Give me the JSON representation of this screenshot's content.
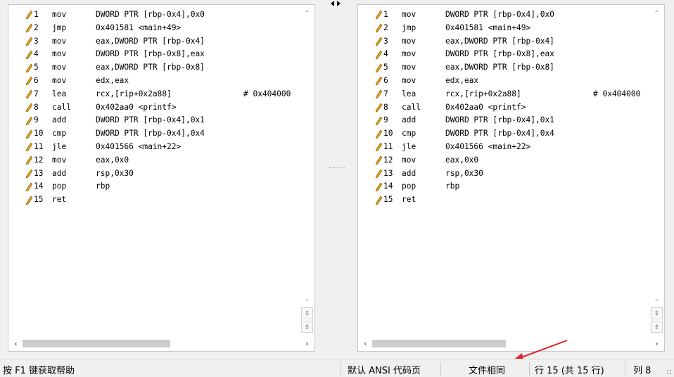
{
  "window": {
    "splitter_icon": "split-arrows-icon"
  },
  "left_pane": {
    "lines": [
      {
        "num": "1",
        "mnemonic": "mov",
        "operands": "DWORD PTR [rbp-0x4],0x0",
        "comment": ""
      },
      {
        "num": "2",
        "mnemonic": "jmp",
        "operands": "0x401581 <main+49>",
        "comment": ""
      },
      {
        "num": "3",
        "mnemonic": "mov",
        "operands": "eax,DWORD PTR [rbp-0x4]",
        "comment": ""
      },
      {
        "num": "4",
        "mnemonic": "mov",
        "operands": "DWORD PTR [rbp-0x8],eax",
        "comment": ""
      },
      {
        "num": "5",
        "mnemonic": "mov",
        "operands": "eax,DWORD PTR [rbp-0x8]",
        "comment": ""
      },
      {
        "num": "6",
        "mnemonic": "mov",
        "operands": "edx,eax",
        "comment": ""
      },
      {
        "num": "7",
        "mnemonic": "lea",
        "operands": "rcx,[rip+0x2a88]",
        "comment": "# 0x404000"
      },
      {
        "num": "8",
        "mnemonic": "call",
        "operands": "0x402aa0 <printf>",
        "comment": ""
      },
      {
        "num": "9",
        "mnemonic": "add",
        "operands": "DWORD PTR [rbp-0x4],0x1",
        "comment": ""
      },
      {
        "num": "10",
        "mnemonic": "cmp",
        "operands": "DWORD PTR [rbp-0x4],0x4",
        "comment": ""
      },
      {
        "num": "11",
        "mnemonic": "jle",
        "operands": "0x401566 <main+22>",
        "comment": ""
      },
      {
        "num": "12",
        "mnemonic": "mov",
        "operands": "eax,0x0",
        "comment": ""
      },
      {
        "num": "13",
        "mnemonic": "add",
        "operands": "rsp,0x30",
        "comment": ""
      },
      {
        "num": "14",
        "mnemonic": "pop",
        "operands": "rbp",
        "comment": ""
      },
      {
        "num": "15",
        "mnemonic": "ret",
        "operands": "",
        "comment": ""
      }
    ]
  },
  "right_pane": {
    "lines": [
      {
        "num": "1",
        "mnemonic": "mov",
        "operands": "DWORD PTR [rbp-0x4],0x0",
        "comment": ""
      },
      {
        "num": "2",
        "mnemonic": "jmp",
        "operands": "0x401581 <main+49>",
        "comment": ""
      },
      {
        "num": "3",
        "mnemonic": "mov",
        "operands": "eax,DWORD PTR [rbp-0x4]",
        "comment": ""
      },
      {
        "num": "4",
        "mnemonic": "mov",
        "operands": "DWORD PTR [rbp-0x8],eax",
        "comment": ""
      },
      {
        "num": "5",
        "mnemonic": "mov",
        "operands": "eax,DWORD PTR [rbp-0x8]",
        "comment": ""
      },
      {
        "num": "6",
        "mnemonic": "mov",
        "operands": "edx,eax",
        "comment": ""
      },
      {
        "num": "7",
        "mnemonic": "lea",
        "operands": "rcx,[rip+0x2a88]",
        "comment": "# 0x404000"
      },
      {
        "num": "8",
        "mnemonic": "call",
        "operands": "0x402aa0 <printf>",
        "comment": ""
      },
      {
        "num": "9",
        "mnemonic": "add",
        "operands": "DWORD PTR [rbp-0x4],0x1",
        "comment": ""
      },
      {
        "num": "10",
        "mnemonic": "cmp",
        "operands": "DWORD PTR [rbp-0x4],0x4",
        "comment": ""
      },
      {
        "num": "11",
        "mnemonic": "jle",
        "operands": "0x401566 <main+22>",
        "comment": ""
      },
      {
        "num": "12",
        "mnemonic": "mov",
        "operands": "eax,0x0",
        "comment": ""
      },
      {
        "num": "13",
        "mnemonic": "add",
        "operands": "rsp,0x30",
        "comment": ""
      },
      {
        "num": "14",
        "mnemonic": "pop",
        "operands": "rbp",
        "comment": ""
      },
      {
        "num": "15",
        "mnemonic": "ret",
        "operands": "",
        "comment": ""
      }
    ]
  },
  "status_bar": {
    "help": "按 F1 键获取帮助",
    "encoding": "默认 ANSI 代码页",
    "compare_result": "文件相同",
    "line_info": "行 15 (共 15 行)",
    "col_info": "列 8"
  },
  "colors": {
    "pencil": "#e3a21a",
    "annotation_arrow": "#e02020"
  }
}
